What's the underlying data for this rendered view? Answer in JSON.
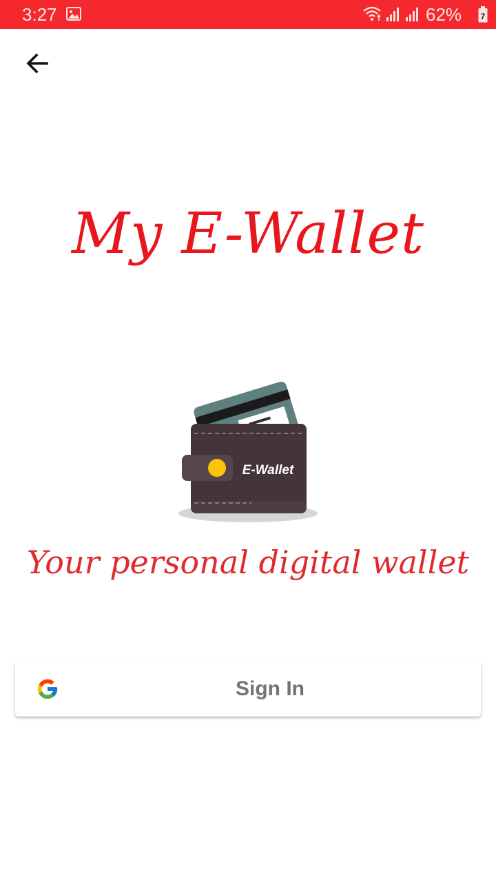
{
  "colors": {
    "accent": "#f4282d",
    "title": "#e8161d",
    "tagline": "#df2a2e"
  },
  "status_bar": {
    "time": "3:27",
    "battery_percent": "62%",
    "battery_level_digit": "7",
    "icons": [
      "gallery-icon",
      "wifi-icon",
      "cell-signal-icon",
      "cell-signal-icon",
      "battery-charging-icon"
    ]
  },
  "header": {
    "back_icon": "arrow-left-icon"
  },
  "main": {
    "title": "My E-Wallet",
    "illustration": {
      "icon": "wallet-icon",
      "label": "E-Wallet"
    },
    "tagline": "Your personal digital wallet"
  },
  "signin": {
    "icon": "google-icon",
    "label": "Sign In"
  }
}
